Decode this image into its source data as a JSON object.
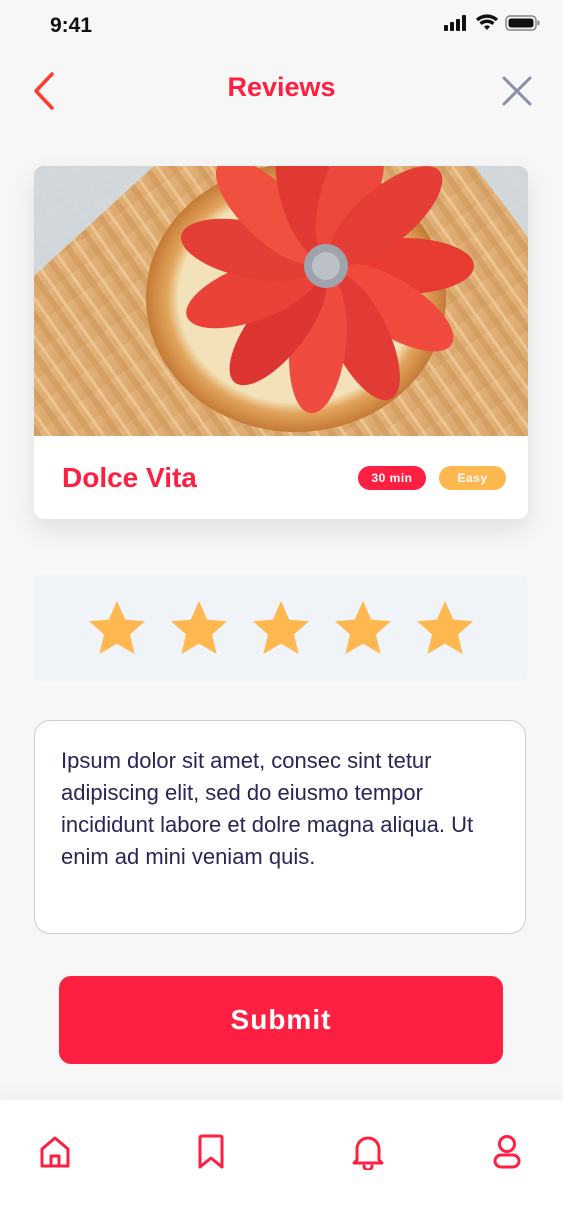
{
  "status_bar": {
    "time": "9:41",
    "icons": [
      "signal-icon",
      "wifi-icon",
      "battery-icon"
    ]
  },
  "header": {
    "title": "Reviews",
    "back_icon": "chevron-left-icon",
    "close_icon": "close-icon"
  },
  "recipe": {
    "name": "Dolce Vita",
    "time_badge": "30 min",
    "difficulty_badge": "Easy",
    "image": "strawberry-tart-photo"
  },
  "rating": {
    "value": 5,
    "max": 5,
    "star_icon": "star-icon"
  },
  "review": {
    "text": "Ipsum dolor sit amet, consec sint tetur adipiscing elit, sed do eiusmo tempor incididunt labore et dolre magna aliqua. Ut enim ad mini veniam quis."
  },
  "submit": {
    "label": "Submit"
  },
  "bottom_nav": {
    "items": [
      {
        "icon": "home-icon"
      },
      {
        "icon": "bookmark-icon"
      },
      {
        "icon": "bell-icon"
      },
      {
        "icon": "profile-icon"
      }
    ]
  },
  "colors": {
    "accent": "#ff1f40",
    "star": "#ffb74f",
    "rating_background": "#f0f4f9",
    "text_dark": "#262657"
  }
}
